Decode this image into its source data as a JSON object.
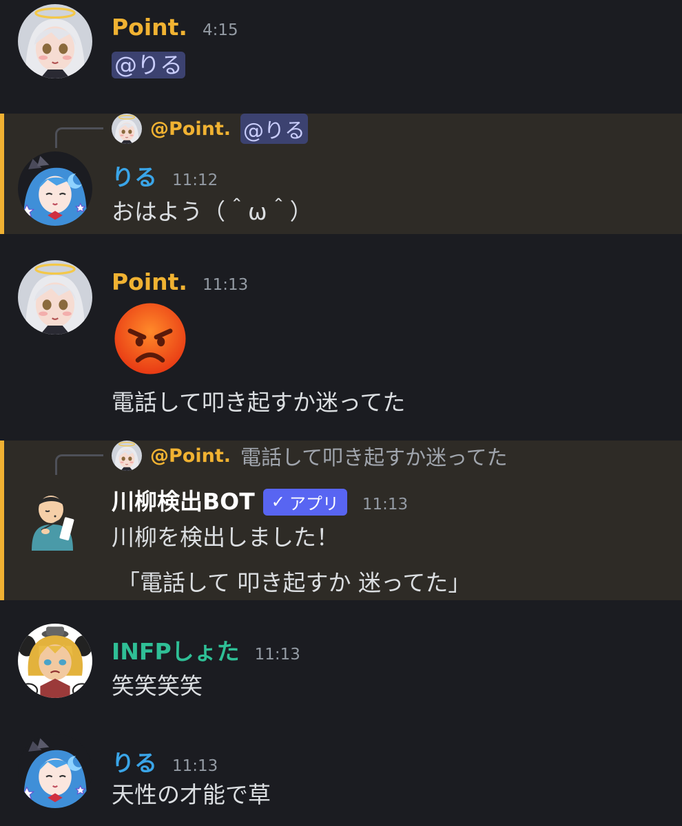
{
  "colors": {
    "background": "#1b1c21",
    "highlight_bg": "#2e2b26",
    "highlight_bar": "#f0b132",
    "point_color": "#f0b232",
    "riru_color": "#3aa5e8",
    "bot_color": "#ffffff",
    "infp_color": "#2fbf96",
    "mention_bg": "#3c4270",
    "badge_bg": "#5865f2"
  },
  "messages": [
    {
      "author": "Point.",
      "time": "4:15",
      "mention": "@りる",
      "avatar": "angel-girl-avatar"
    },
    {
      "reply_author": "@Point.",
      "reply_mention": "@りる",
      "author": "りる",
      "time": "11:12",
      "text": "おはよう（＾ω＾）",
      "avatar": "blue-hair-girl-avatar"
    },
    {
      "author": "Point.",
      "time": "11:13",
      "emoji": "angry-face-emoji",
      "text": "電話して叩き起すか迷ってた",
      "avatar": "angel-girl-avatar"
    },
    {
      "reply_author": "@Point.",
      "reply_text": "電話して叩き起すか迷ってた",
      "author": "川柳検出BOT",
      "badge": "アプリ",
      "time": "11:13",
      "text": "川柳を検出しました！",
      "quote": "「電話して 叩き起すか 迷ってた」",
      "avatar": "poet-man-avatar"
    },
    {
      "author": "INFPしょた",
      "time": "11:13",
      "text": "笑笑笑笑",
      "avatar": "blonde-boy-avatar"
    },
    {
      "author": "りる",
      "time": "11:13",
      "text": "天性の才能で草",
      "avatar": "blue-hair-girl-avatar"
    }
  ]
}
